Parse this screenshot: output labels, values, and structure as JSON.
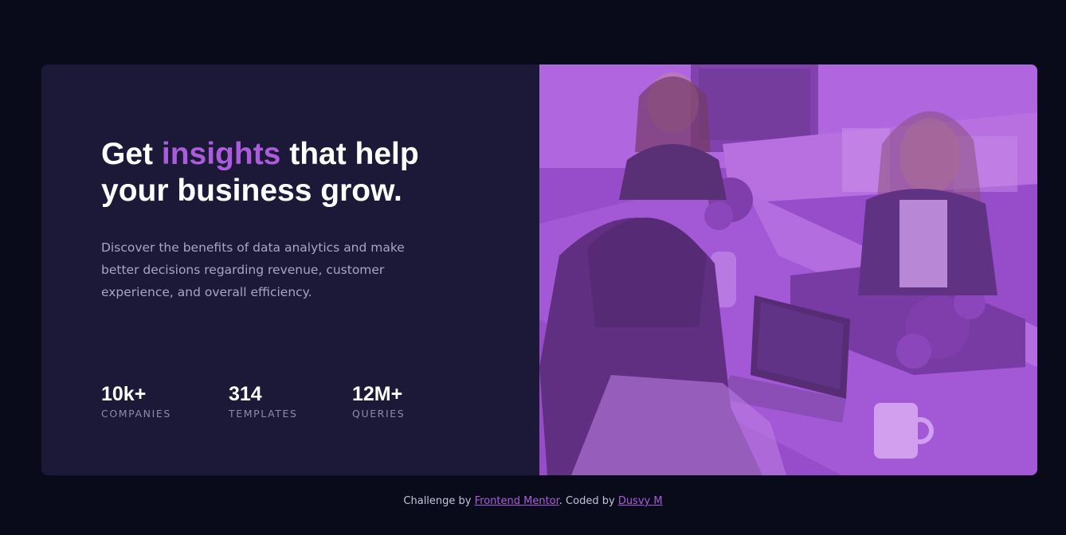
{
  "hero": {
    "headline_before": "Get ",
    "headline_accent": "insights",
    "headline_after": " that help your business grow.",
    "description": "Discover the benefits of data analytics and make better decisions regarding revenue, customer experience, and overall efficiency."
  },
  "stats": [
    {
      "value": "10k+",
      "label": "COMPANIES"
    },
    {
      "value": "314",
      "label": "TEMPLATES"
    },
    {
      "value": "12M+",
      "label": "QUERIES"
    }
  ],
  "image": {
    "icon": "office-photo",
    "tint_color": "#aa5cdb"
  },
  "footer": {
    "prefix": "Challenge by ",
    "link1": "Frontend Mentor",
    "middle": ". Coded by ",
    "link2": "Dusvy M"
  },
  "colors": {
    "page_background": "#090b1b",
    "card_background": "#1b1937",
    "accent": "#ab5cdb"
  }
}
